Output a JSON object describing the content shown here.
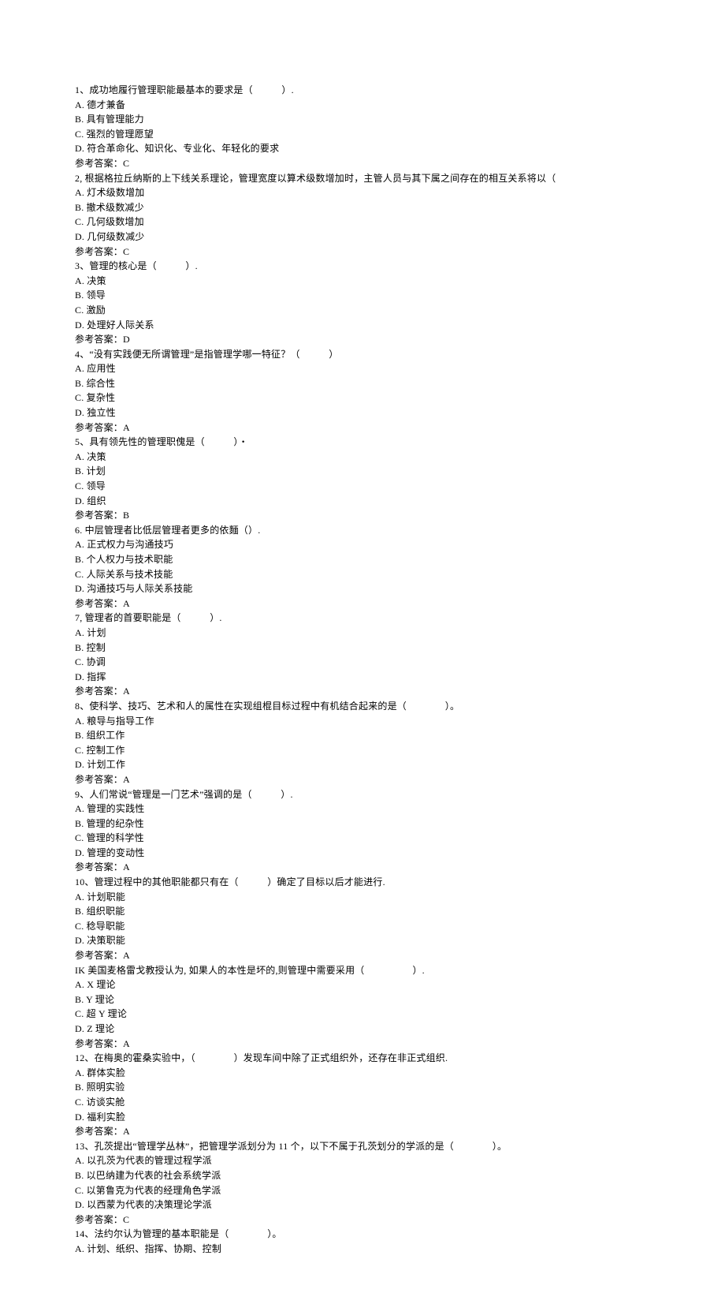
{
  "questions": [
    {
      "stem": "1、成功地履行管理职能最基本的要求是（　　　）.",
      "opts": [
        "A. 德才兼备",
        "B. 具有管理能力",
        "C. 强烈的管理愿望",
        "D. 符合革命化、知识化、专业化、年轻化的要求"
      ],
      "ans": "参考答案：C"
    },
    {
      "stem": "2, 根据格拉丘纳斯的上下线关系理论，管理宽度以算术级数增加时，主管人员与其下属之间存在的相互关系将以（",
      "opts": [
        "A. 灯术级数增加",
        "B. 撤术级数减少",
        "C. 几何级数增加",
        "D. 几何级数减少"
      ],
      "ans": "参考答案：C"
    },
    {
      "stem": "3、管理的核心是（　　　）.",
      "opts": [
        "A. 决策",
        "B. 领导",
        "C. 激励",
        "D. 处理好人际关系"
      ],
      "ans": "参考答案：D"
    },
    {
      "stem": "4、“没有实践便无所谓管理”是指管理学哪一特征？（　　　）",
      "opts": [
        "A. 应用性",
        "B. 综合性",
        "C. 复杂性",
        "D. 独立性"
      ],
      "ans": "参考答案：A"
    },
    {
      "stem": "5、具有领先性的管理职傀是（　　　）・",
      "opts": [
        "A. 决策",
        "B. 计划",
        "C. 领导",
        "D. 组织"
      ],
      "ans": "参考答案：B"
    },
    {
      "stem": "6. 中层管理者比低层管理者更多的依麵（）.",
      "opts": [
        "A. 正式权力与沟通技巧",
        "B. 个人权力与技术职能",
        "C. 人际关系与技术技能",
        "D. 沟通技巧与人际关系技能"
      ],
      "ans": "参考答案：A"
    },
    {
      "stem": "7, 管理者的首要职能是（　　　）.",
      "opts": [
        "A. 计划",
        "B. 控制",
        "C. 协调",
        "D. 指挥"
      ],
      "ans": "参考答案：A"
    },
    {
      "stem": "8、使科学、技巧、艺术和人的属性在实现组棍目标过程中有机结合起来的是（　　　　）。",
      "opts": [
        "A. 粮导与指导工作",
        "B. 组织工作",
        "C. 控制工作",
        "D. 计划工作"
      ],
      "ans": "参考答案：A"
    },
    {
      "stem": "9、人们常说“管理是一门艺术”强调的是（　　　）.",
      "opts": [
        "A. 管理的实践性",
        "B. 管理的纪杂性",
        "C. 管理的科学性",
        "D. 管理的变动性"
      ],
      "ans": "参考答案：A"
    },
    {
      "stem": "10、管理过程中的其他职能都只有在（　　　）确定了目标以后才能进行.",
      "opts": [
        "A. 计划职能",
        "B. 组织职能",
        "C. 稔导职能",
        "D. 决策职能"
      ],
      "ans": "参考答案：A"
    },
    {
      "stem": "IK 美国麦格雷戈教授认为, 如果人的本性是坏的,则管理中需要采用（　　　　　）.",
      "opts": [
        "A. X 理论",
        "B. Y 理论",
        "C. 超 Y 理论",
        "D. Z 理论"
      ],
      "ans": "参考答案：A"
    },
    {
      "stem": "12、在梅奥的霍桑实验中，（　　　　）发现车间中除了正式组织外，还存在非正式组织.",
      "opts": [
        "A. 群体实脸",
        "B. 照明实验",
        "C. 访谈实舱",
        "D. 福利实脸"
      ],
      "ans": "参考答案：A"
    },
    {
      "stem": "13、孔茨提出“管理学丛林”，把管理学派划分为 11 个，以下不属于孔茨划分的学派的是（　　　　）。",
      "opts": [
        "A. 以孔茨为代表的管理过程学派",
        "B. 以巴纳建为代表的社会系统学派",
        "C. 以第鲁克为代表的经理角色学派",
        "D. 以西蒙为代表的决策理论学派"
      ],
      "ans": "参考答案：C"
    },
    {
      "stem": "14、法约尔认为管理的基本职能是（　　　　）。",
      "opts": [
        "A. 计划、纸织、指挥、协期、控制"
      ],
      "ans": null
    }
  ]
}
